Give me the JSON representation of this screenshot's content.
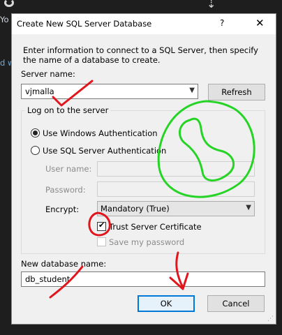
{
  "background": {
    "fragment_1": "Yo",
    "fragment_2": "d w"
  },
  "dialog": {
    "title": "Create New SQL Server Database",
    "help_glyph": "?",
    "close_glyph": "✕",
    "intro": "Enter information to connect to a SQL Server, then specify the name of a database to create.",
    "server_name_label": "Server name:",
    "server_name_value": "vjmalla",
    "refresh_label": "Refresh",
    "logon_group_title": "Log on to the server",
    "auth_windows_label": "Use Windows Authentication",
    "auth_sql_label": "Use SQL Server Authentication",
    "selected_auth": "windows",
    "user_name_label": "User name:",
    "password_label": "Password:",
    "encrypt_label": "Encrypt:",
    "encrypt_value": "Mandatory (True)",
    "trust_cert_label": "Trust Server Certificate",
    "trust_cert_checked": true,
    "save_password_label": "Save my password",
    "save_password_checked": false,
    "db_name_label": "New database name:",
    "db_name_value": "db_student",
    "ok_label": "OK",
    "cancel_label": "Cancel"
  },
  "annotation_colors": {
    "red": "#e0161c",
    "green": "#26d426"
  }
}
